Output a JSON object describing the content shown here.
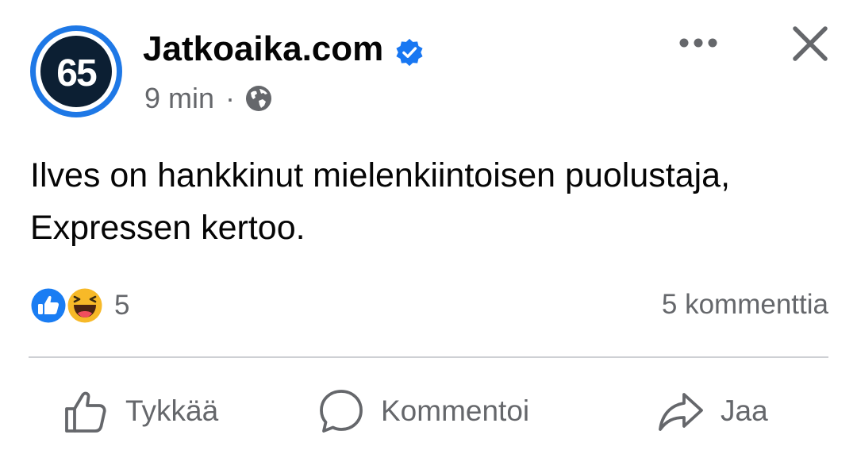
{
  "post": {
    "page_name": "Jatkoaika.com",
    "avatar_text": "65",
    "time": "9 min",
    "separator": "·",
    "text": "Ilves on hankkinut mielenkiintoisen puolustaja, Expressen kertoo.",
    "reaction_count": "5",
    "comment_count": "5 kommenttia"
  },
  "icons": {
    "verified": "verified-badge-icon",
    "privacy": "globe-icon",
    "more": "more-options-icon",
    "close": "close-icon",
    "reaction_1": "like-reaction-icon",
    "reaction_2": "haha-reaction-icon"
  },
  "actions": {
    "like_label": "Tykkää",
    "comment_label": "Kommentoi",
    "share_label": "Jaa"
  },
  "colors": {
    "brand_blue": "#1877f2",
    "text": "#050505",
    "secondary_text": "#65676b",
    "divider": "#ced0d4",
    "avatar_dark": "#0c1f33"
  }
}
